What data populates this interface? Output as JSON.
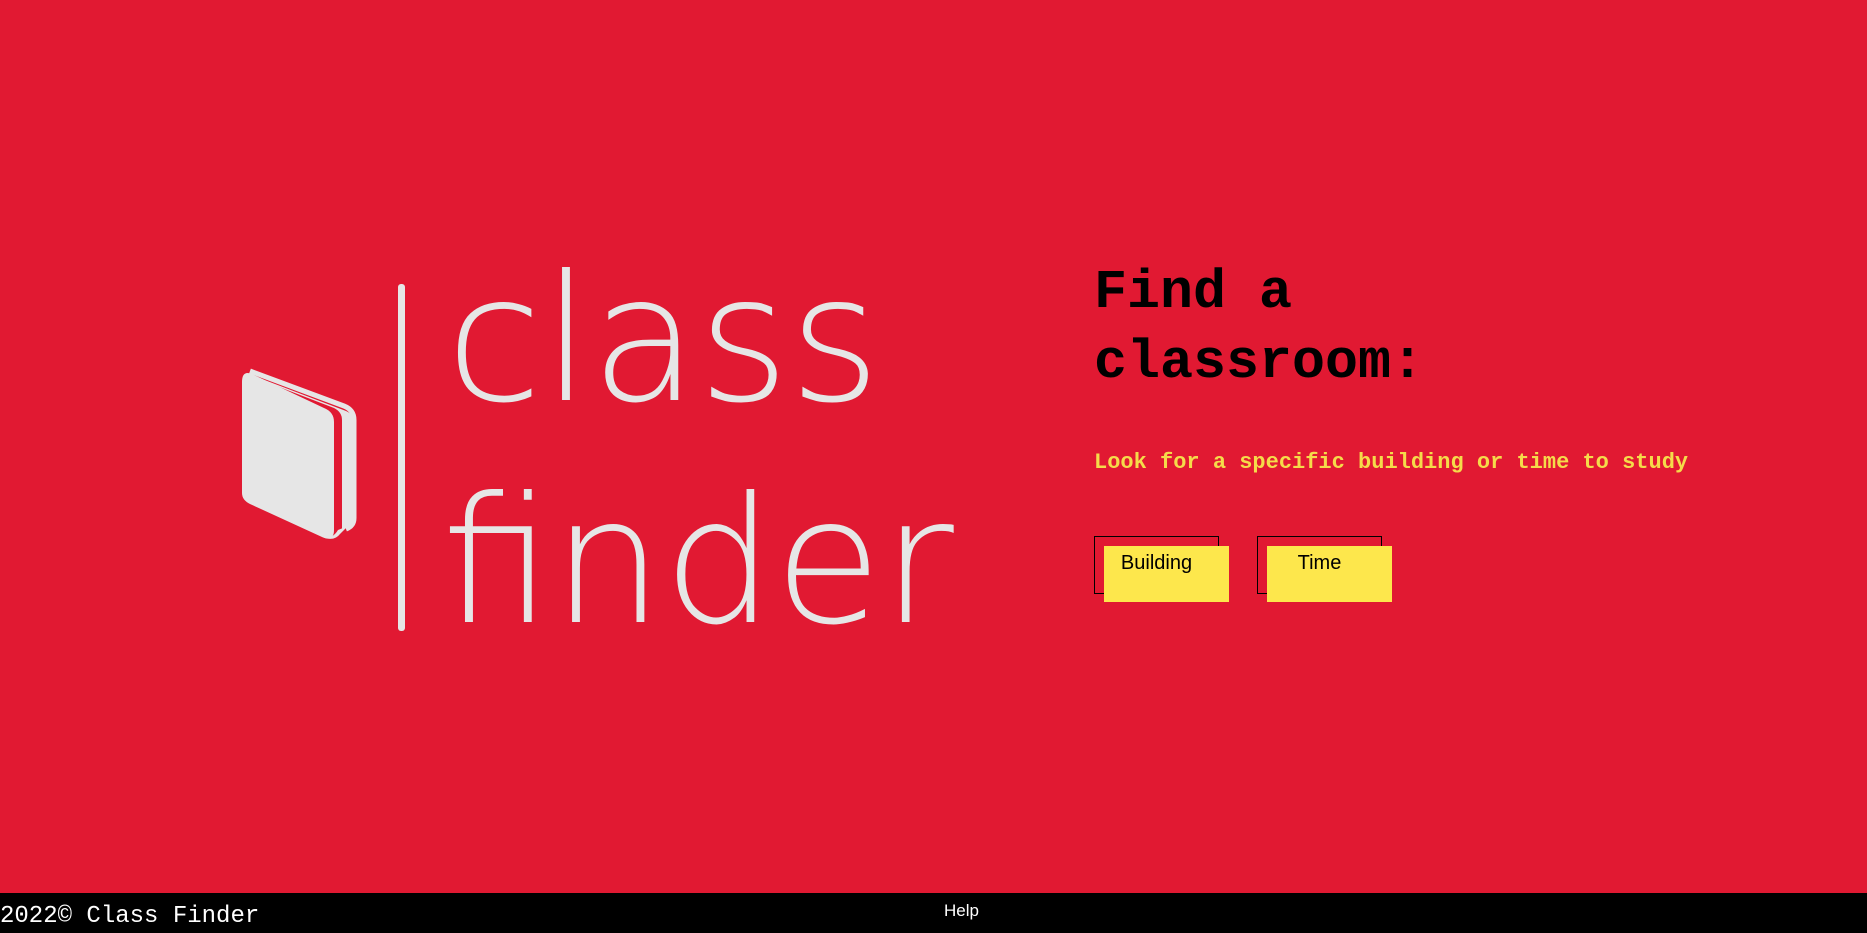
{
  "logo": {
    "alt": "class finder",
    "line1": "class",
    "line2": "finder",
    "icon": "book-icon"
  },
  "main": {
    "heading": "Find a classroom:",
    "subtitle": "Look for a specific building or time to study",
    "buttons": [
      {
        "label": "Building"
      },
      {
        "label": "Time"
      }
    ]
  },
  "footer": {
    "copyright": "2022© Class Finder",
    "help_link": "Help"
  },
  "colors": {
    "background": "#e11932",
    "accent_yellow": "#fde74c",
    "subtitle_yellow": "#f5db4a",
    "logo_gray": "#e6e6e6",
    "footer": "#000000"
  }
}
